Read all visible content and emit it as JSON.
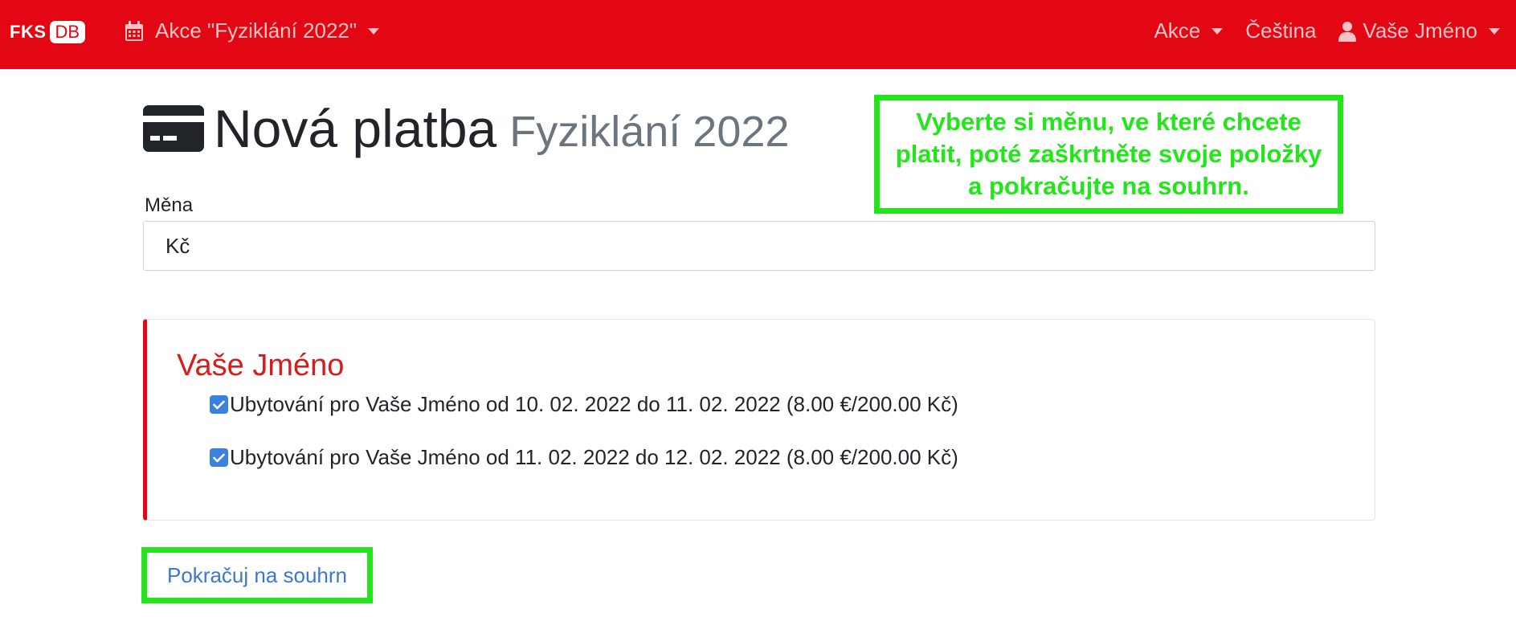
{
  "navbar": {
    "brand_fks": "FKS",
    "brand_db": "DB",
    "event_selector": "Akce \"Fyziklání 2022\"",
    "menu_akce": "Akce",
    "language": "Čeština",
    "user": "Vaše Jméno"
  },
  "page": {
    "title": "Nová platba",
    "subtitle": "Fyziklání 2022"
  },
  "hint": {
    "text": "Vyberte si měnu, ve které chcete platit, poté zaškrtněte svoje položky a pokračujte na souhrn."
  },
  "form": {
    "currency_label": "Měna",
    "currency_value": "Kč"
  },
  "person": {
    "name": "Vaše Jméno",
    "items": [
      {
        "label": "Ubytování pro Vaše Jméno od 10. 02. 2022 do 11. 02. 2022 (8.00 €/200.00 Kč)",
        "checked": true
      },
      {
        "label": "Ubytování pro Vaše Jméno od 11. 02. 2022 do 12. 02. 2022 (8.00 €/200.00 Kč)",
        "checked": true
      }
    ]
  },
  "actions": {
    "continue_label": "Pokračuj na souhrn"
  },
  "colors": {
    "navbar": "#e30613",
    "highlight": "#22e61a",
    "person_name": "#d51d1d",
    "link": "#3a78d6"
  }
}
